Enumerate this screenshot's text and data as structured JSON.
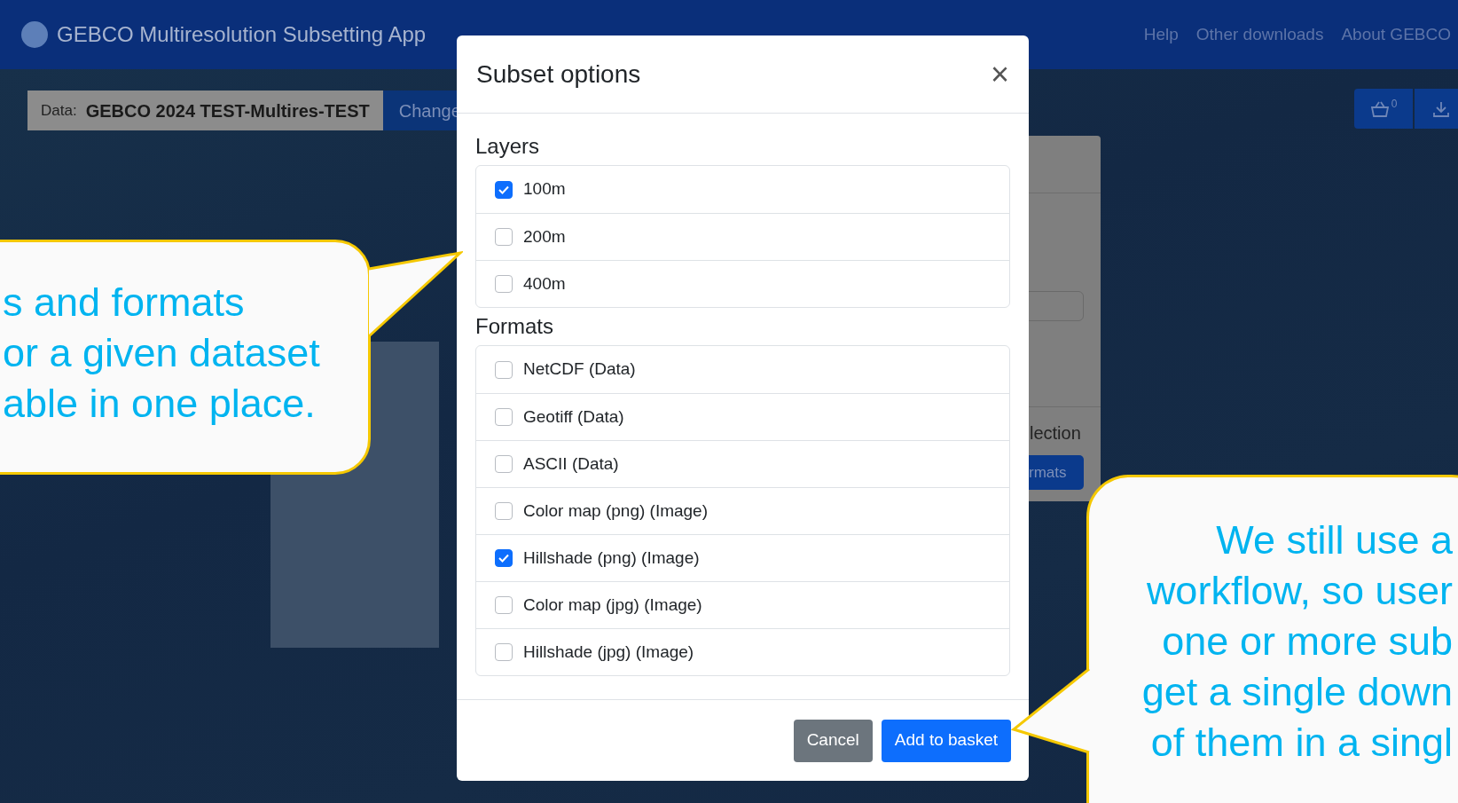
{
  "navbar": {
    "title": "GEBCO Multiresolution Subsetting App",
    "links": [
      "Help",
      "Other downloads",
      "About GEBCO"
    ]
  },
  "data_bar": {
    "label": "Data:",
    "value": "GEBCO 2024 TEST-Multires-TEST",
    "change": "Change"
  },
  "toolbar": {
    "basket_count": "0"
  },
  "side_panel": {
    "text": "lection",
    "button": "rmats"
  },
  "modal": {
    "title": "Subset options",
    "close": "×",
    "sections": [
      {
        "heading": "Layers",
        "options": [
          {
            "label": "100m",
            "checked": true
          },
          {
            "label": "200m",
            "checked": false
          },
          {
            "label": "400m",
            "checked": false
          }
        ]
      },
      {
        "heading": "Formats",
        "options": [
          {
            "label": "NetCDF (Data)",
            "checked": false
          },
          {
            "label": "Geotiff (Data)",
            "checked": false
          },
          {
            "label": "ASCII (Data)",
            "checked": false
          },
          {
            "label": "Color map (png) (Image)",
            "checked": false
          },
          {
            "label": "Hillshade (png) (Image)",
            "checked": true
          },
          {
            "label": "Color map (jpg) (Image)",
            "checked": false
          },
          {
            "label": "Hillshade (jpg) (Image)",
            "checked": false
          }
        ]
      }
    ],
    "buttons": [
      {
        "label": "Cancel",
        "kind": "secondary"
      },
      {
        "label": "Add to basket",
        "kind": "primary"
      }
    ]
  },
  "callouts": [
    {
      "kind": "left",
      "lines": [
        "s and formats",
        "or a given dataset",
        "able in one place."
      ]
    },
    {
      "kind": "right",
      "lines": [
        "We still use a",
        "workflow, so user",
        "one or more sub",
        "get a single down",
        "of them in a singl"
      ]
    }
  ]
}
